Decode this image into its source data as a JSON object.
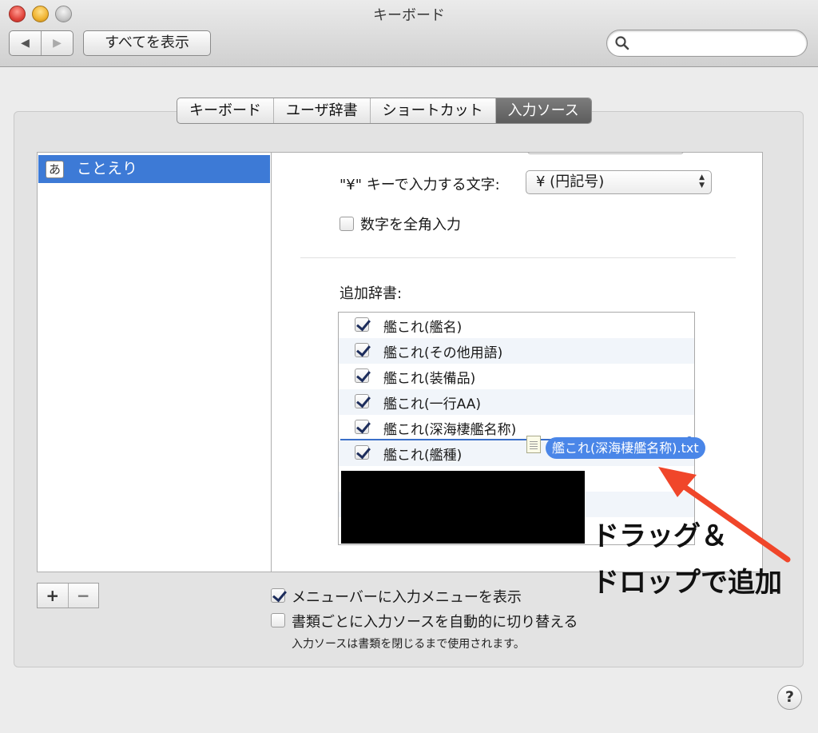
{
  "window": {
    "title": "キーボード",
    "back_icon": "◀",
    "forward_icon": "▶",
    "show_all": "すべてを表示",
    "search_placeholder": ""
  },
  "tabs": [
    {
      "label": "キーボード",
      "active": false
    },
    {
      "label": "ユーザ辞書",
      "active": false
    },
    {
      "label": "ショートカット",
      "active": false
    },
    {
      "label": "入力ソース",
      "active": true
    }
  ],
  "sources": {
    "items": [
      {
        "icon_text": "あ",
        "label": "ことえり",
        "selected": true
      }
    ]
  },
  "detail": {
    "yen_label": "\"¥\" キーで入力する文字:",
    "yen_value": "¥ (円記号)",
    "fullwidth_numbers": {
      "label": "数字を全角入力",
      "checked": false
    },
    "dict_label": "追加辞書:",
    "dictionaries": [
      {
        "label": "艦これ(艦名)",
        "checked": true
      },
      {
        "label": "艦これ(その他用語)",
        "checked": true
      },
      {
        "label": "艦これ(装備品)",
        "checked": true
      },
      {
        "label": "艦これ(一行AA)",
        "checked": true
      },
      {
        "label": "艦これ(深海棲艦名称)",
        "checked": true
      },
      {
        "label": "艦これ(艦種)",
        "checked": true
      }
    ]
  },
  "drag": {
    "file_name": "艦これ(深海棲艦名称).txt"
  },
  "annotation": {
    "line1": "ドラッグ＆",
    "line2": "ドロップで追加",
    "arrow_color": "#f0462a"
  },
  "bottom": {
    "add": "+",
    "remove": "−",
    "show_menu": {
      "label": "メニューバーに入力メニューを表示",
      "checked": true
    },
    "auto_switch": {
      "label": "書類ごとに入力ソースを自動的に切り替える",
      "checked": false
    },
    "note": "入力ソースは書類を閉じるまで使用されます。",
    "help": "?"
  }
}
